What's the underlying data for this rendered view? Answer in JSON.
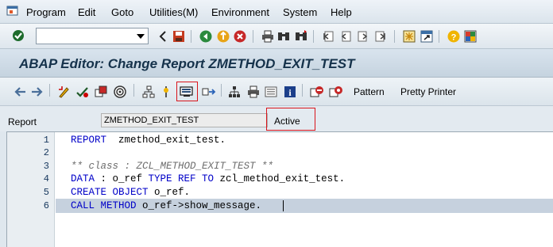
{
  "menubar": {
    "items": [
      "Program",
      "Edit",
      "Goto",
      "Utilities(M)",
      "Environment",
      "System",
      "Help"
    ]
  },
  "system_toolbar": {
    "command_field_value": "",
    "icons": [
      "enter-check-icon",
      "back-arrow-icon",
      "save-icon",
      "back-icon",
      "exit-icon",
      "cancel-icon",
      "print-icon",
      "find-icon",
      "find-next-icon",
      "first-page-icon",
      "previous-page-icon",
      "next-page-icon",
      "last-page-icon",
      "create-session-icon",
      "shortcut-icon",
      "help-icon",
      "customize-layout-icon"
    ]
  },
  "title": {
    "text": "ABAP Editor: Change Report ZMETHOD_EXIT_TEST"
  },
  "app_toolbar": {
    "pattern_label": "Pattern",
    "pretty_printer_label": "Pretty Printer"
  },
  "report": {
    "label": "Report",
    "name": "ZMETHOD_EXIT_TEST",
    "status": "Active"
  },
  "editor": {
    "line_numbers": [
      "1",
      "2",
      "3",
      "4",
      "5",
      "6"
    ],
    "selected_line": 6
  },
  "colors": {
    "keyword": "#0000c8",
    "comment": "#6d6d6d",
    "highlight_box": "#d9141b",
    "title_text": "#15324b"
  }
}
